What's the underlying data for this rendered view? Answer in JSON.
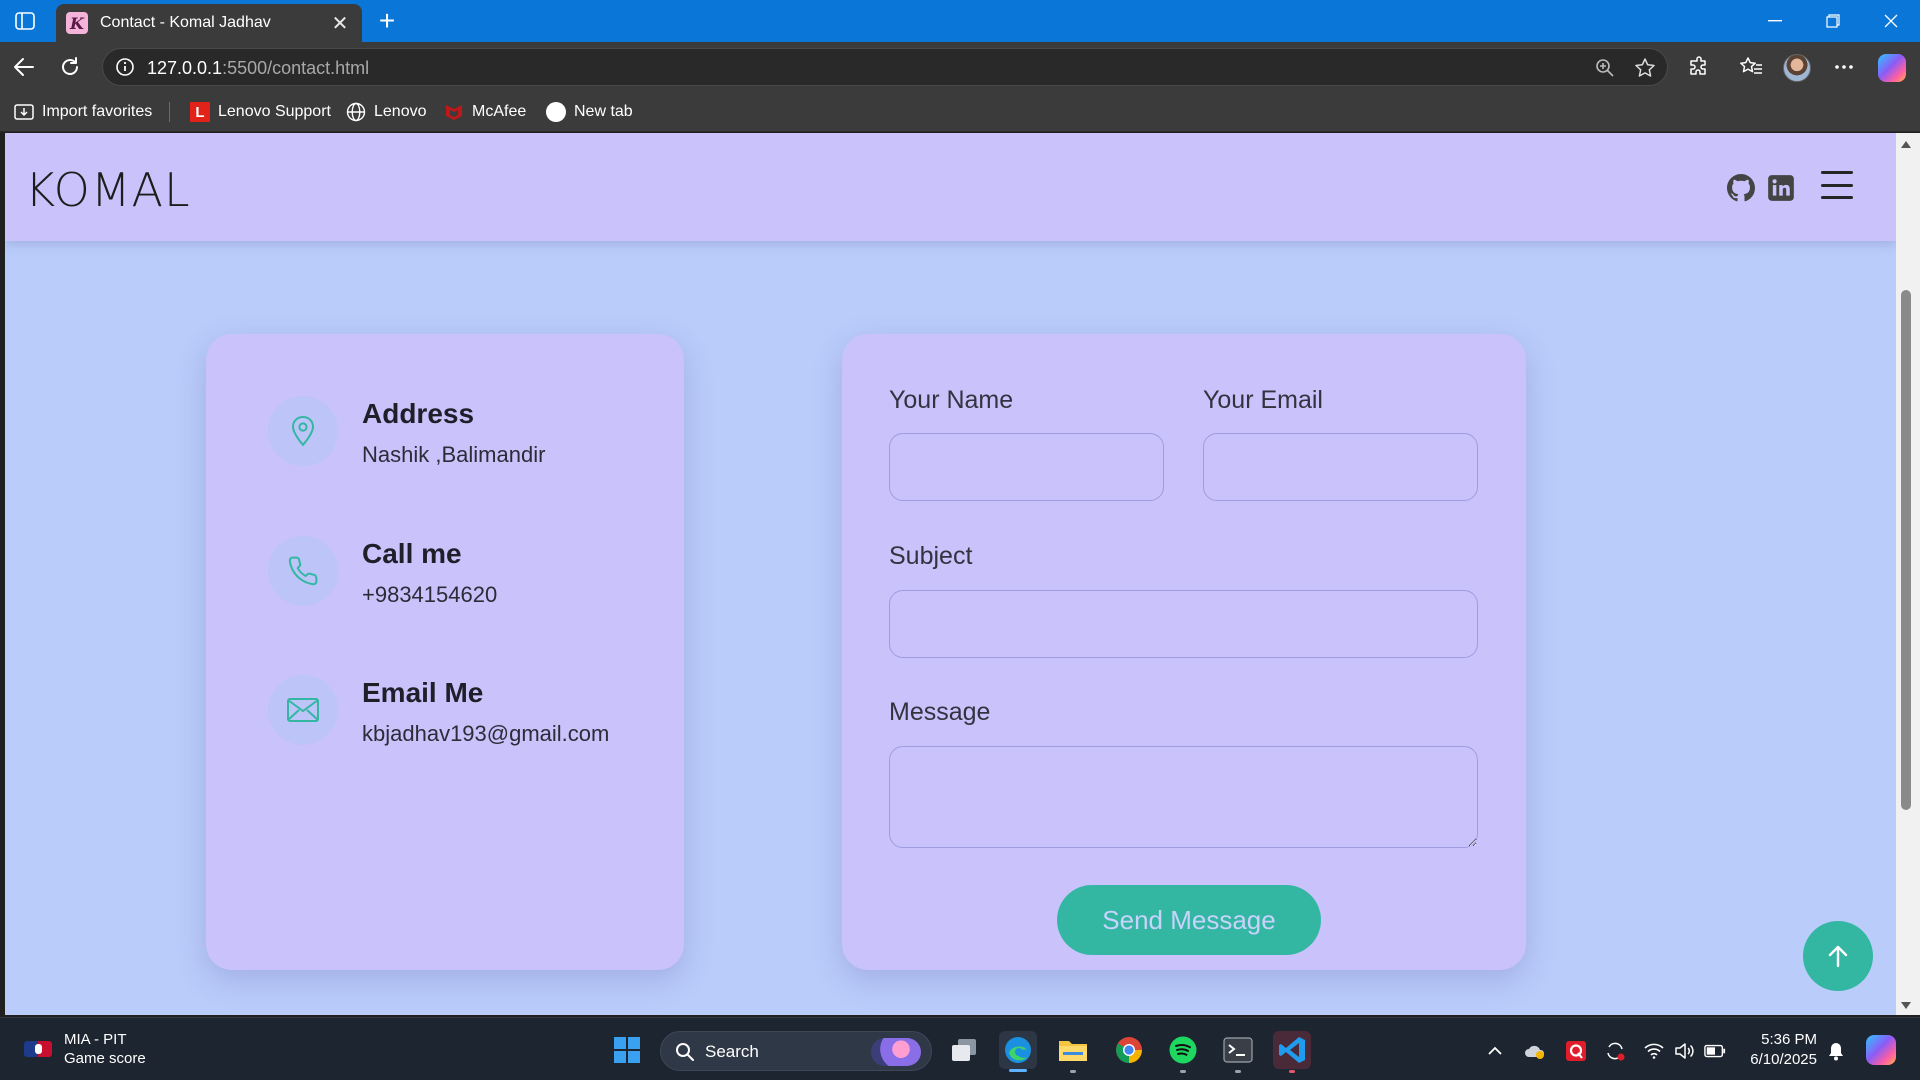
{
  "browser": {
    "tab_title": "Contact - Komal Jadhav",
    "tab_favicon": "K",
    "url_host": "127.0.0.1",
    "url_rest": ":5500/contact.html",
    "favorites": [
      {
        "label": "Import favorites",
        "icon": "import-icon"
      },
      {
        "label": "Lenovo Support",
        "icon": "lenovo-logo-icon"
      },
      {
        "label": "Lenovo",
        "icon": "globe-icon"
      },
      {
        "label": "McAfee",
        "icon": "mcafee-logo-icon"
      },
      {
        "label": "New tab",
        "icon": "new-tab-icon"
      }
    ]
  },
  "site": {
    "logo": "KOMAL",
    "nav_icons": [
      "github-icon",
      "linkedin-icon",
      "hamburger-menu-icon"
    ],
    "accent_color": "#33b7a3",
    "background_color": "#b9ccfa",
    "card_color": "#c9c2fb"
  },
  "contact_info": {
    "address": {
      "title": "Address",
      "value": "Nashik ,Balimandir",
      "icon": "location-pin-icon"
    },
    "phone": {
      "title": "Call me",
      "value": "+9834154620",
      "icon": "phone-icon"
    },
    "email": {
      "title": "Email Me",
      "value": "kbjadhav193@gmail.com",
      "icon": "envelope-icon"
    }
  },
  "form": {
    "name_label": "Your Name",
    "email_label": "Your Email",
    "subject_label": "Subject",
    "message_label": "Message",
    "name_value": "",
    "email_value": "",
    "subject_value": "",
    "message_value": "",
    "submit_label": "Send Message"
  },
  "taskbar": {
    "widget_title": "MIA - PIT",
    "widget_subtitle": "Game score",
    "search_placeholder": "Search",
    "time": "5:36 PM",
    "date": "6/10/2025"
  }
}
